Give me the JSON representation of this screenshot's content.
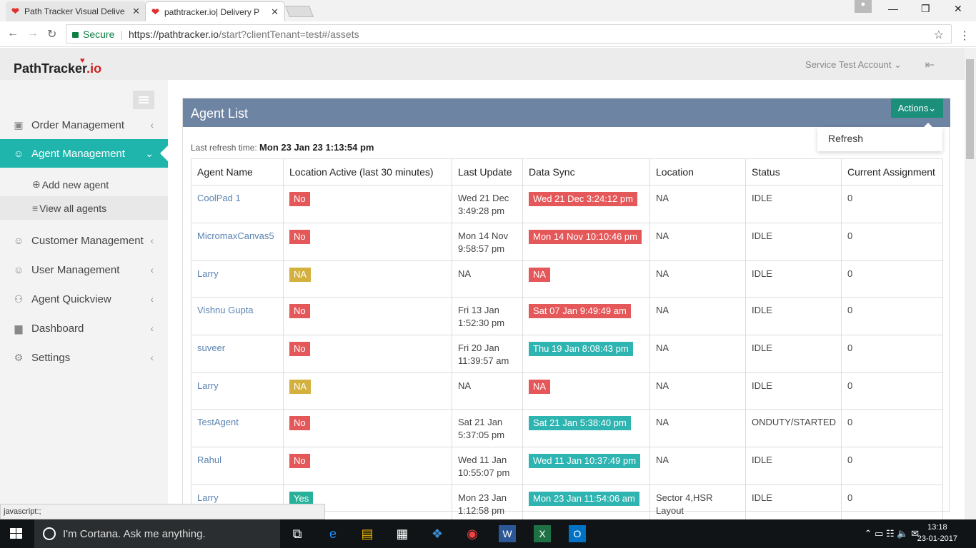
{
  "browser": {
    "tabs": [
      {
        "title": "Path Tracker Visual Delive"
      },
      {
        "title": "pathtracker.io| Delivery P"
      }
    ],
    "secure_label": "Secure",
    "url_host": "https://pathtracker.io",
    "url_rest": "/start?clientTenant=test#/assets"
  },
  "header": {
    "brand_main": "PathTracker",
    "brand_suffix": ".io",
    "account": "Service Test Account"
  },
  "sidebar": {
    "items": [
      {
        "label": "Order Management",
        "icon": "truck-icon"
      },
      {
        "label": "Agent Management",
        "icon": "user-icon"
      },
      {
        "label": "Customer Management",
        "icon": "user-icon"
      },
      {
        "label": "User Management",
        "icon": "user-icon"
      },
      {
        "label": "Agent Quickview",
        "icon": "bike-icon"
      },
      {
        "label": "Dashboard",
        "icon": "bar-chart-icon"
      },
      {
        "label": "Settings",
        "icon": "gear-icon"
      }
    ],
    "subitems": [
      {
        "label": "Add new agent"
      },
      {
        "label": "View all agents"
      }
    ]
  },
  "panel": {
    "title": "Agent List",
    "actions_label": "Actions",
    "dropdown_item": "Refresh",
    "refresh_label": "Last refresh time:",
    "refresh_time": "Mon 23 Jan 23 1:13:54 pm"
  },
  "table": {
    "headers": [
      "Agent Name",
      "Location Active (last 30 minutes)",
      "Last Update",
      "Data Sync",
      "Location",
      "Status",
      "Current Assignment"
    ],
    "rows": [
      {
        "name": "CoolPad 1",
        "active": "No",
        "update": [
          "Wed 21 Dec",
          "3:49:28 pm"
        ],
        "sync": "Wed 21 Dec 3:24:12 pm",
        "location": [
          "NA"
        ],
        "status": "IDLE",
        "assign": "0"
      },
      {
        "name": "MicromaxCanvas5",
        "active": "No",
        "update": [
          "Mon 14 Nov",
          "9:58:57 pm"
        ],
        "sync": "Mon 14 Nov 10:10:46 pm",
        "location": [
          "NA"
        ],
        "status": "IDLE",
        "assign": "0"
      },
      {
        "name": "Larry",
        "active": "NA",
        "update": [
          "NA",
          ""
        ],
        "sync": "NA",
        "location": [
          "NA"
        ],
        "status": "IDLE",
        "assign": "0"
      },
      {
        "name": "Vishnu Gupta",
        "active": "No",
        "update": [
          "Fri 13 Jan",
          "1:52:30 pm"
        ],
        "sync": "Sat 07 Jan 9:49:49 am",
        "location": [
          "NA"
        ],
        "status": "IDLE",
        "assign": "0"
      },
      {
        "name": "suveer",
        "active": "No",
        "update": [
          "Fri 20 Jan",
          "11:39:57 am"
        ],
        "sync": "Thu 19 Jan 8:08:43 pm",
        "location": [
          "NA"
        ],
        "status": "IDLE",
        "assign": "0"
      },
      {
        "name": "Larry",
        "active": "NA",
        "update": [
          "NA",
          ""
        ],
        "sync": "NA",
        "location": [
          "NA"
        ],
        "status": "IDLE",
        "assign": "0"
      },
      {
        "name": "TestAgent",
        "active": "No",
        "update": [
          "Sat 21 Jan",
          "5:37:05 pm"
        ],
        "sync": "Sat 21 Jan 5:38:40 pm",
        "location": [
          "NA"
        ],
        "status": "ONDUTY/STARTED",
        "assign": "0"
      },
      {
        "name": "Rahul",
        "active": "No",
        "update": [
          "Wed 11 Jan",
          "10:55:07 pm"
        ],
        "sync": "Wed 11 Jan 10:37:49 pm",
        "location": [
          "NA"
        ],
        "status": "IDLE",
        "assign": "0"
      },
      {
        "name": "Larry",
        "active": "Yes",
        "update": [
          "Mon 23 Jan",
          "1:12:58 pm"
        ],
        "sync": "Mon 23 Jan 11:54:06 am",
        "location": [
          "Sector 4,HSR",
          "Layout"
        ],
        "status": "IDLE",
        "assign": "0"
      }
    ]
  },
  "statusbar": "javascript:;",
  "taskbar": {
    "cortana": "I'm Cortana. Ask me anything.",
    "time": "13:18",
    "date": "23-01-2017"
  },
  "colors": {
    "accent": "#1fb5ac",
    "panel_header": "#6e84a3",
    "red_label": "#e5585a",
    "yellow_label": "#d4b13f",
    "green_label": "#28b19a",
    "teal_label": "#2eb4b1",
    "link": "#5b84b1"
  }
}
